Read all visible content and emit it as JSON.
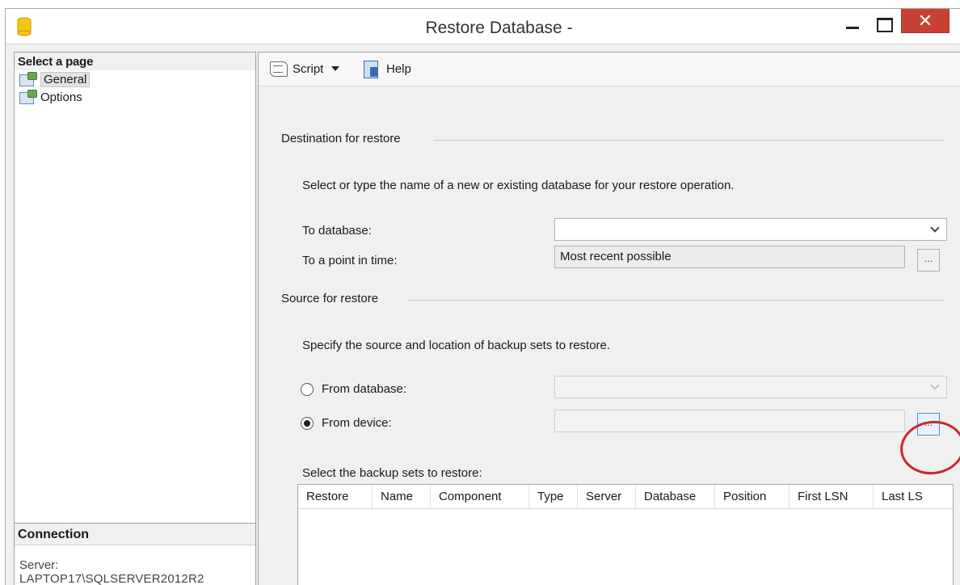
{
  "window": {
    "title": "Restore Database -",
    "close_glyph": "✕"
  },
  "left_pane": {
    "header": "Select a page",
    "pages": [
      {
        "label": "General",
        "icon": "page-icon",
        "selected": true
      },
      {
        "label": "Options",
        "icon": "page-icon",
        "selected": false
      }
    ],
    "connection_header": "Connection",
    "server_label": "Server:",
    "server_value": "LAPTOP17\\SQLSERVER2012R2"
  },
  "toolbar": {
    "script_label": "Script",
    "help_label": "Help"
  },
  "destination": {
    "group_title": "Destination for restore",
    "instructions": "Select or type the name of a new or existing database for your restore operation.",
    "to_database_label": "To database:",
    "to_database_value": "",
    "point_in_time_label": "To a point in time:",
    "point_in_time_value": "Most recent possible",
    "ellipsis": "..."
  },
  "source": {
    "group_title": "Source for restore",
    "instructions": "Specify the source and location of backup sets to restore.",
    "from_database_label": "From database:",
    "from_database_selected": false,
    "from_device_label": "From device:",
    "from_device_selected": true,
    "from_device_value": "",
    "ellipsis": "..."
  },
  "backup_sets": {
    "label": "Select the backup sets to restore:",
    "columns": [
      "Restore",
      "Name",
      "Component",
      "Type",
      "Server",
      "Database",
      "Position",
      "First LSN",
      "Last LS"
    ]
  },
  "colors": {
    "annotation_circle": "#c9262c",
    "close_button": "#c74135"
  }
}
